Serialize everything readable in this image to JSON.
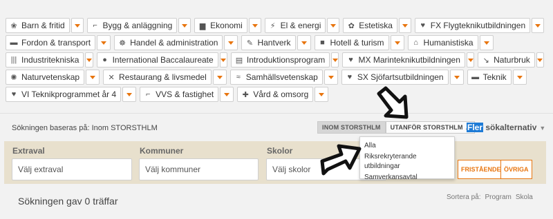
{
  "tag_rows": [
    [
      {
        "icon": "❀",
        "icon_name": "child-icon",
        "label": "Barn & fritid"
      },
      {
        "icon": "⌐",
        "icon_name": "crane-icon",
        "label": "Bygg & anläggning"
      },
      {
        "icon": "▆",
        "icon_name": "chart-icon",
        "label": "Ekonomi"
      },
      {
        "icon": "⚡",
        "icon_name": "plug-icon",
        "label": "El & energi"
      },
      {
        "icon": "✿",
        "icon_name": "nail-polish-icon",
        "label": "Estetiska"
      },
      {
        "icon": "♥",
        "icon_name": "heart-icon",
        "label": "FX Flygteknikutbildningen"
      }
    ],
    [
      {
        "icon": "▬",
        "icon_name": "truck-icon",
        "label": "Fordon & transport"
      },
      {
        "icon": "☸",
        "icon_name": "handshake-icon",
        "label": "Handel & administration"
      },
      {
        "icon": "✎",
        "icon_name": "tools-icon",
        "label": "Hantverk"
      },
      {
        "icon": "■",
        "icon_name": "suitcase-icon",
        "label": "Hotell & turism"
      },
      {
        "icon": "⌂",
        "icon_name": "columns-icon",
        "label": "Humanistiska"
      }
    ],
    [
      {
        "icon": "|||",
        "icon_name": "barcode-icon",
        "label": "Industritekniska"
      },
      {
        "icon": "●",
        "icon_name": "globe-icon",
        "label": "International Baccalaureate"
      },
      {
        "icon": "▤",
        "icon_name": "book-icon",
        "label": "Introduktionsprogram"
      },
      {
        "icon": "♥",
        "icon_name": "heart-icon",
        "label": "MX Marinteknikutbildningen"
      },
      {
        "icon": "↘",
        "icon_name": "leaf-icon",
        "label": "Naturbruk"
      }
    ],
    [
      {
        "icon": "✺",
        "icon_name": "atom-icon",
        "label": "Naturvetenskap"
      },
      {
        "icon": "✕",
        "icon_name": "cutlery-icon",
        "label": "Restaurang & livsmedel"
      },
      {
        "icon": "≈",
        "icon_name": "people-icon",
        "label": "Samhällsvetenskap"
      },
      {
        "icon": "♥",
        "icon_name": "heart-icon",
        "label": "SX Sjöfartsutbildningen"
      },
      {
        "icon": "▬",
        "icon_name": "laptop-icon",
        "label": "Teknik"
      }
    ],
    [
      {
        "icon": "♥",
        "icon_name": "heart-icon",
        "label": "VI Teknikprogrammet år 4"
      },
      {
        "icon": "⌐",
        "icon_name": "wrench-icon",
        "label": "VVS & fastighet"
      },
      {
        "icon": "✚",
        "icon_name": "medical-icon",
        "label": "Vård & omsorg"
      }
    ]
  ],
  "search_basis": "Sökningen baseras på: Inom STORSTHLM",
  "scope_toggle": {
    "inside": "INOM STORSTHLM",
    "outside": "UTANFÖR STORSTHLM"
  },
  "more_options": {
    "highlight": "Fler",
    "rest": " sökalternativ"
  },
  "filters": {
    "extraval": {
      "label": "Extraval",
      "placeholder": "Välj extraval"
    },
    "kommuner": {
      "label": "Kommuner",
      "placeholder": "Välj kommuner"
    },
    "skolor": {
      "label": "Skolor",
      "placeholder": "Välj skolor"
    }
  },
  "filter_buttons": {
    "friestaende": "FRISTÅENDE",
    "ovriga": "ÖVRIGA"
  },
  "dropdown_options": [
    "Alla",
    "Riksrekryterande utbildningar",
    "Samverkansavtal"
  ],
  "results_text": "Sökningen gav 0 träffar",
  "sort": {
    "label": "Sortera på:",
    "program": "Program",
    "skola": "Skola"
  },
  "colors": {
    "accent": "#e8750f",
    "highlight": "#1e7bd6",
    "panel": "#e8e0cd"
  }
}
